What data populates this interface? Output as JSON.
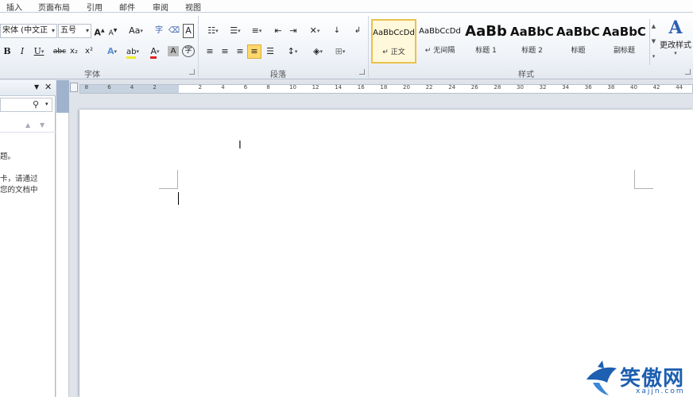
{
  "ribbon": {
    "tabs": [
      "插入",
      "页面布局",
      "引用",
      "邮件",
      "审阅",
      "视图"
    ],
    "font": {
      "font_name": "宋体 (中文正",
      "font_size": "五号",
      "grow_label": "A",
      "shrink_label": "A",
      "case_label": "Aa",
      "phonetic_label": "字",
      "border_label": "A",
      "bold": "B",
      "italic": "I",
      "underline": "U",
      "strike": "abc",
      "subscript": "x₂",
      "superscript": "x²",
      "highlight_label": "ab",
      "font_color_label": "A",
      "shading_label": "A",
      "enclose_label": "字",
      "group_label": "字体"
    },
    "paragraph": {
      "group_label": "段落"
    },
    "styles": {
      "items": [
        {
          "sample": "AaBbCcDd",
          "name": "↵ 正文"
        },
        {
          "sample": "AaBbCcDd",
          "name": "↵ 无间隔"
        },
        {
          "sample": "AaBb",
          "name": "标题 1"
        },
        {
          "sample": "AaBbC",
          "name": "标题 2"
        },
        {
          "sample": "AaBbC",
          "name": "标题"
        },
        {
          "sample": "AaBbC",
          "name": "副标题"
        }
      ],
      "change_label": "更改样式",
      "group_label": "样式"
    }
  },
  "nav": {
    "text_lines": [
      "题。",
      "卡，请通过",
      "您的文档中"
    ]
  },
  "ruler": {
    "numbers": [
      "8",
      "6",
      "4",
      "2",
      "2",
      "4",
      "6",
      "8",
      "10",
      "12",
      "14",
      "16",
      "18",
      "20",
      "22",
      "24",
      "26",
      "28",
      "30",
      "32",
      "34",
      "36",
      "38",
      "40",
      "42",
      "44"
    ]
  },
  "watermark": {
    "text": "笑傲网",
    "url": "xajjn.com"
  }
}
